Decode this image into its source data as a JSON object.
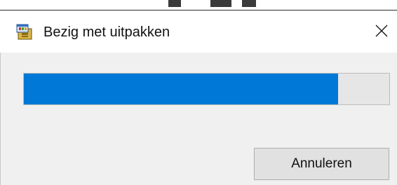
{
  "window": {
    "title": "Bezig met uitpakken",
    "icon": "archive-extract-icon",
    "close_icon": "close-icon"
  },
  "progress": {
    "value": 0.86,
    "fill_color": "#0078d7"
  },
  "buttons": {
    "cancel_label": "Annuleren"
  }
}
